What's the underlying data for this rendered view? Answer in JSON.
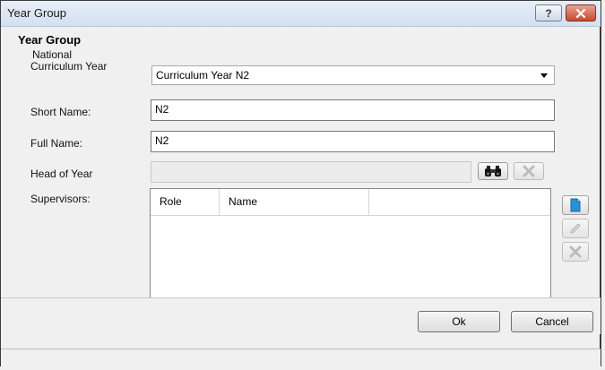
{
  "window": {
    "title": "Year Group",
    "help_label": "?"
  },
  "section": {
    "title": "Year Group"
  },
  "national_curriculum": {
    "label_line1": "National",
    "label_line2": "Curriculum Year",
    "value": "Curriculum Year N2"
  },
  "short_name": {
    "label": "Short Name:",
    "value": "N2"
  },
  "full_name": {
    "label": "Full Name:",
    "value": "N2"
  },
  "head_of_year": {
    "label": "Head of Year",
    "value": ""
  },
  "supervisors": {
    "label": "Supervisors:",
    "columns": [
      "Role",
      "Name",
      ""
    ]
  },
  "footer": {
    "ok_label": "Ok",
    "cancel_label": "Cancel"
  },
  "colors": {
    "accent": "#2a8fd6",
    "close_red": "#c74a31"
  }
}
